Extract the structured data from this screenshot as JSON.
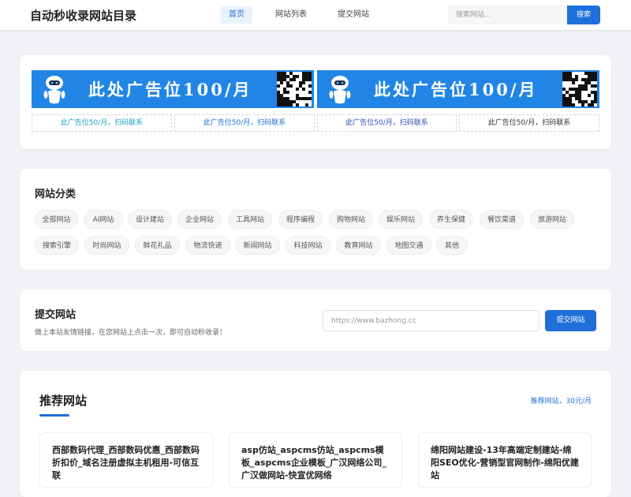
{
  "header": {
    "logo": "自动秒收录网站目录",
    "nav": [
      {
        "label": "首页",
        "active": true
      },
      {
        "label": "网站列表",
        "active": false
      },
      {
        "label": "提交网站",
        "active": false
      }
    ],
    "search_placeholder": "搜索网站...",
    "search_button": "搜索"
  },
  "ads": {
    "banners": [
      {
        "text": "此处广告位100/月"
      },
      {
        "text": "此处广告位100/月"
      }
    ],
    "links": [
      {
        "text": "此广告位50/月，扫码联系",
        "color": "#16a3c4"
      },
      {
        "text": "此广告位50/月，扫码联系",
        "color": "#1e6fd9"
      },
      {
        "text": "此广告位50/月，扫码联系",
        "color": "#2a4fbf"
      },
      {
        "text": "此广告位50/月，扫码联系",
        "color": "#333333"
      }
    ]
  },
  "categories": {
    "title": "网站分类",
    "items": [
      "全部网站",
      "AI网站",
      "设计建站",
      "企业网站",
      "工具网站",
      "程序编程",
      "购物网站",
      "娱乐网站",
      "养生保健",
      "餐饮菜谱",
      "旅游网站",
      "搜索引擎",
      "时尚网站",
      "鲜花礼品",
      "物流快递",
      "新闻网站",
      "科技网站",
      "教育网站",
      "地图交通",
      "其他"
    ]
  },
  "submit": {
    "title": "提交网站",
    "description": "做上本站友情链接，在您网站上点击一次，即可自动秒收录！",
    "url_placeholder": "https://www.bazhong.cc",
    "button": "提交网站"
  },
  "recommended": {
    "title": "推荐网站",
    "price": "推荐网站，30元/月",
    "sites": [
      {
        "title": "西部数码代理_西部数码优惠_西部数码折扣价_域名注册虚拟主机租用-可信互联"
      },
      {
        "title": "asp仿站_aspcms仿站_aspcms模板_aspcms企业模板_广汉网络公司_广汉做网站-快宣优网络"
      },
      {
        "title": "绵阳网站建设-13年高端定制建站-绵阳SEO优化-营销型官网制作-绵阳优建站"
      }
    ]
  },
  "colors": {
    "accent": "#1e6fd9",
    "banner": "#2185e5",
    "background": "#f0f2f5"
  }
}
